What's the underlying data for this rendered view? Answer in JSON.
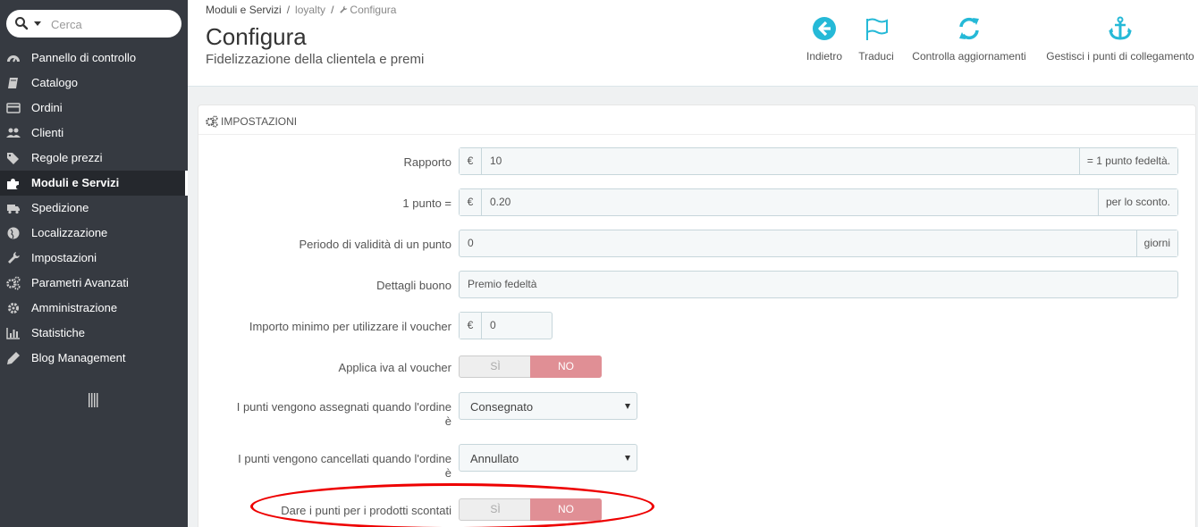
{
  "search": {
    "placeholder": "Cerca"
  },
  "sidebar": {
    "items": [
      {
        "label": "Pannello di controllo",
        "icon": "dashboard-icon"
      },
      {
        "label": "Catalogo",
        "icon": "book-icon"
      },
      {
        "label": "Ordini",
        "icon": "credit-card-icon"
      },
      {
        "label": "Clienti",
        "icon": "users-icon"
      },
      {
        "label": "Regole prezzi",
        "icon": "tags-icon"
      },
      {
        "label": "Moduli e Servizi",
        "icon": "puzzle-icon",
        "active": true
      },
      {
        "label": "Spedizione",
        "icon": "truck-icon"
      },
      {
        "label": "Localizzazione",
        "icon": "globe-icon"
      },
      {
        "label": "Impostazioni",
        "icon": "wrench-icon"
      },
      {
        "label": "Parametri Avanzati",
        "icon": "cogs-icon"
      },
      {
        "label": "Amministrazione",
        "icon": "cog-icon"
      },
      {
        "label": "Statistiche",
        "icon": "bar-chart-icon"
      },
      {
        "label": "Blog Management",
        "icon": "pencil-icon"
      }
    ]
  },
  "breadcrumb": {
    "level1": "Moduli e Servizi",
    "level2": "loyalty",
    "level3": "Configura"
  },
  "header": {
    "title": "Configura",
    "subtitle": "Fidelizzazione della clientela e premi"
  },
  "toolbar": {
    "back": "Indietro",
    "translate": "Traduci",
    "updates": "Controlla aggiornamenti",
    "hooks": "Gestisci i punti di collegamento"
  },
  "panel": {
    "title": "IMPOSTAZIONI",
    "ratio": {
      "label": "Rapporto",
      "prefix": "€",
      "value": "10",
      "suffix": "= 1 punto fedeltà."
    },
    "point_value": {
      "label": "1 punto =",
      "prefix": "€",
      "value": "0.20",
      "suffix": "per lo sconto."
    },
    "validity": {
      "label": "Periodo di validità di un punto",
      "value": "0",
      "suffix": "giorni"
    },
    "voucher_details": {
      "label": "Dettagli buono",
      "value": "Premio fedeltà"
    },
    "min_amount": {
      "label": "Importo minimo per utilizzare il voucher",
      "prefix": "€",
      "value": "0"
    },
    "apply_tax": {
      "label": "Applica iva al voucher",
      "yes": "SÌ",
      "no": "NO",
      "selected": "NO"
    },
    "assigned_state": {
      "label_line1": "I punti vengono assegnati quando l'ordine",
      "label_line2": "è",
      "value": "Consegnato"
    },
    "cancelled_state": {
      "label_line1": "I punti vengono cancellati quando l'ordine",
      "label_line2": "è",
      "value": "Annullato"
    },
    "discounted_products": {
      "label": "Dare i punti per i prodotti scontati",
      "yes": "SÌ",
      "no": "NO",
      "selected": "NO"
    }
  },
  "colors": {
    "sidebar_bg": "#363a41",
    "accent": "#25b9d7",
    "switch_no": "#e08f95",
    "highlight_ellipse": "#ee0000"
  }
}
